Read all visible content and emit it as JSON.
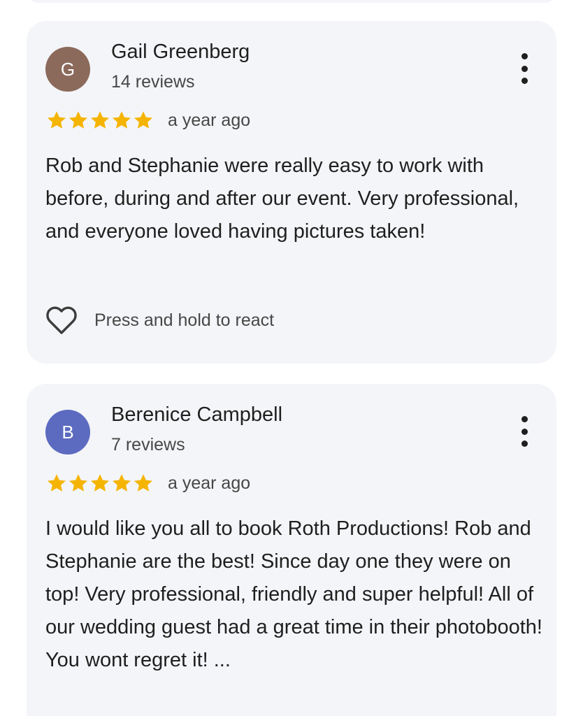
{
  "reviews": [
    {
      "author": "Gail Greenberg",
      "initial": "G",
      "avatar_color": "#8b6a5c",
      "review_count": "14 reviews",
      "rating": 5,
      "time_ago": "a year ago",
      "text": "Rob and Stephanie were really easy to work with before, during and after our event. Very professional, and everyone loved having pictures taken!",
      "react_label": "Press and hold to react",
      "more_icon": "more-vert-icon"
    },
    {
      "author": "Berenice Campbell",
      "initial": "B",
      "avatar_color": "#5c6bc0",
      "review_count": "7 reviews",
      "rating": 5,
      "time_ago": "a year ago",
      "text": "I would like you all to book Roth Productions! Rob and Stephanie are the best! Since day one they were on top! Very professional, friendly and super helpful! All of our wedding guest had a great time in their photobooth! You wont regret it! ...",
      "more_icon": "more-vert-icon"
    }
  ],
  "colors": {
    "card_background": "#f4f5f8",
    "star": "#f5b400",
    "primary_text": "#1f1f1f",
    "secondary_text": "#474747"
  }
}
